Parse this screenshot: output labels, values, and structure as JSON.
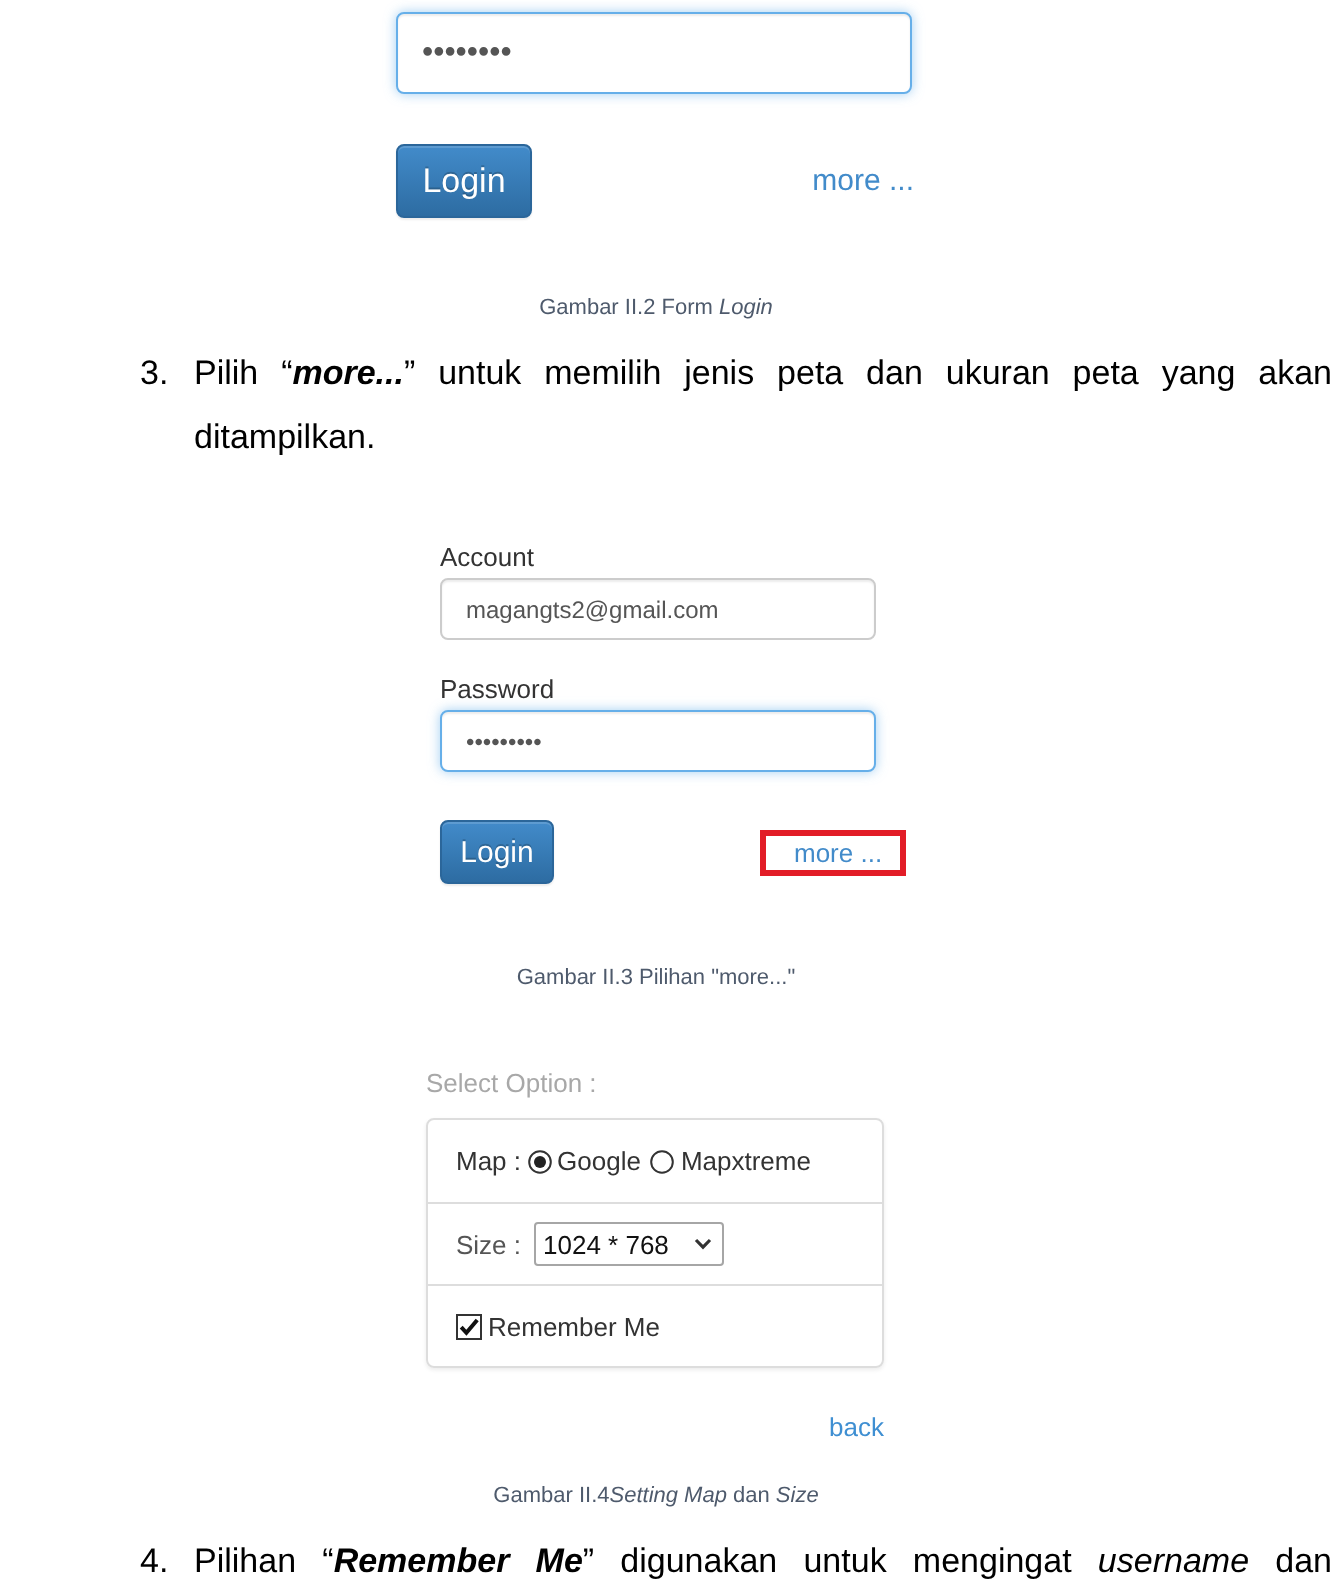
{
  "page": [
    {
      "kind": "login_crop",
      "password": {
        "value": "••••••••",
        "focused": true
      },
      "button": "Login",
      "link": {
        "label": "more ...",
        "highlighted": false
      }
    },
    {
      "kind": "caption",
      "runs": [
        {
          "text": "Gambar II.2 Form ",
          "italic": false
        },
        {
          "text": "Login",
          "italic": true
        }
      ]
    },
    {
      "kind": "step",
      "number": "3.",
      "text": "Pilih “**more...**” untuk memilih jenis peta dan ukuran peta yang akan ditampilkan."
    },
    {
      "kind": "login_form",
      "fields": [
        {
          "label": "Account",
          "value": "magangts2@gmail.com",
          "focused": false
        },
        {
          "label": "Password",
          "value": "•••••••••",
          "focused": true
        }
      ],
      "button": "Login",
      "link": {
        "label": "more ...",
        "highlighted": true
      }
    },
    {
      "kind": "caption",
      "runs": [
        {
          "text": "Gambar II.3 Pilihan \"more...\"",
          "italic": false
        }
      ]
    },
    {
      "kind": "options",
      "heading": "Select Option :",
      "map": {
        "label": "Map :",
        "choices": [
          {
            "label": "Google",
            "selected": true
          },
          {
            "label": "Mapxtreme",
            "selected": false
          }
        ]
      },
      "size": {
        "label": "Size :",
        "value": "1024 * 768"
      },
      "remember": {
        "label": "Remember Me",
        "checked": true
      },
      "back": "back"
    },
    {
      "kind": "caption",
      "runs": [
        {
          "text": "Gambar II.4",
          "italic": false
        },
        {
          "text": "Setting Map",
          "italic": true
        },
        {
          "text": " dan ",
          "italic": false
        },
        {
          "text": "Size",
          "italic": true
        }
      ]
    },
    {
      "kind": "step",
      "number": "4.",
      "text": "Pilihan “**Remember Me**” digunakan untuk mengingat *username* dan"
    }
  ]
}
